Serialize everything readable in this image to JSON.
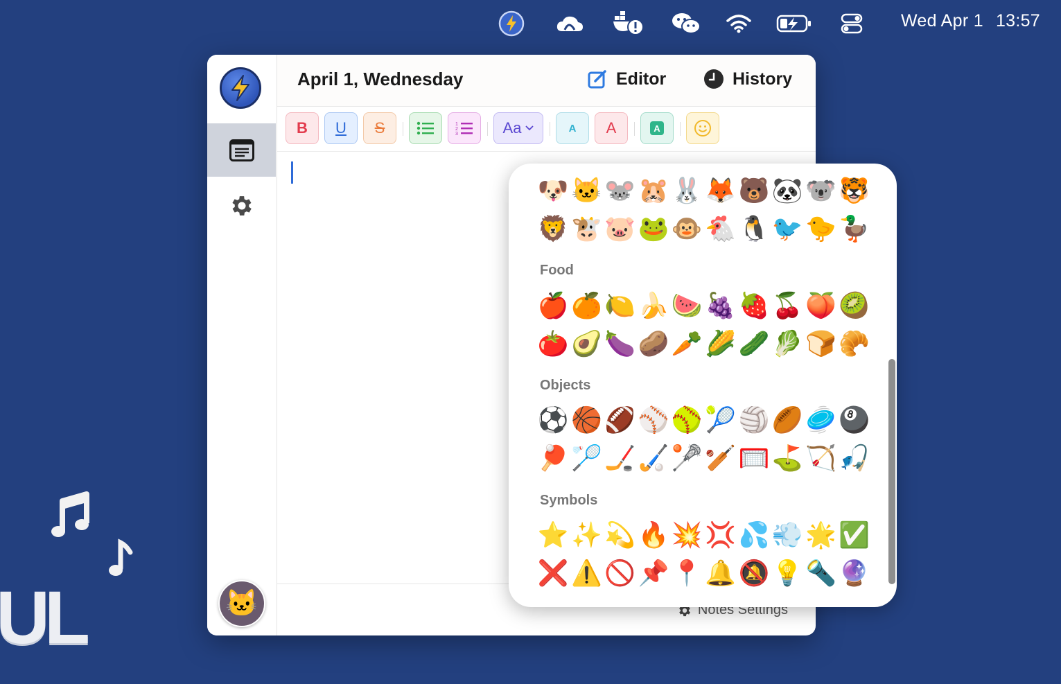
{
  "menubar": {
    "icons": [
      "bolt-app-icon",
      "creative-cloud-icon",
      "docker-icon",
      "wechat-icon",
      "wifi-icon",
      "battery-charging-icon",
      "control-center-icon"
    ],
    "day": "Wed Apr 1",
    "time": "13:57"
  },
  "window": {
    "date_title": "April 1, Wednesday",
    "editor_label": "Editor",
    "history_label": "History",
    "footer_settings": "Notes Settings"
  },
  "toolbar": {
    "bold": "B",
    "underline": "U",
    "strike": "S",
    "font_size": "Aa",
    "text_color_small": "A",
    "text_color": "A",
    "highlight": "A",
    "emoji": "☺"
  },
  "emoji": {
    "animals_row1": [
      "🐶",
      "🐱",
      "🐭",
      "🐹",
      "🐰",
      "🦊",
      "🐻",
      "🐼",
      "🐨",
      "🐯"
    ],
    "animals_row2": [
      "🦁",
      "🐮",
      "🐷",
      "🐸",
      "🐵",
      "🐔",
      "🐧",
      "🐦",
      "🐤",
      "🦆"
    ],
    "food_label": "Food",
    "food_row1": [
      "🍎",
      "🍊",
      "🍋",
      "🍌",
      "🍉",
      "🍇",
      "🍓",
      "🍒",
      "🍑",
      "🥝"
    ],
    "food_row2": [
      "🍅",
      "🥑",
      "🍆",
      "🥔",
      "🥕",
      "🌽",
      "🥒",
      "🥬",
      "🍞",
      "🥐"
    ],
    "objects_label": "Objects",
    "objects_row1": [
      "⚽",
      "🏀",
      "🏈",
      "⚾",
      "🥎",
      "🎾",
      "🏐",
      "🏉",
      "🥏",
      "🎱"
    ],
    "objects_row2": [
      "🏓",
      "🏸",
      "🏒",
      "🏑",
      "🥍",
      "🏏",
      "🥅",
      "⛳",
      "🏹",
      "🎣"
    ],
    "symbols_label": "Symbols",
    "symbols_row1": [
      "⭐",
      "✨",
      "💫",
      "🔥",
      "💥",
      "💢",
      "💦",
      "💨",
      "🌟",
      "✅"
    ],
    "symbols_row2": [
      "❌",
      "⚠️",
      "🚫",
      "📌",
      "📍",
      "🔔",
      "🔕",
      "💡",
      "🔦",
      "🔮"
    ]
  },
  "desktop": {
    "partial_text": "UL"
  }
}
